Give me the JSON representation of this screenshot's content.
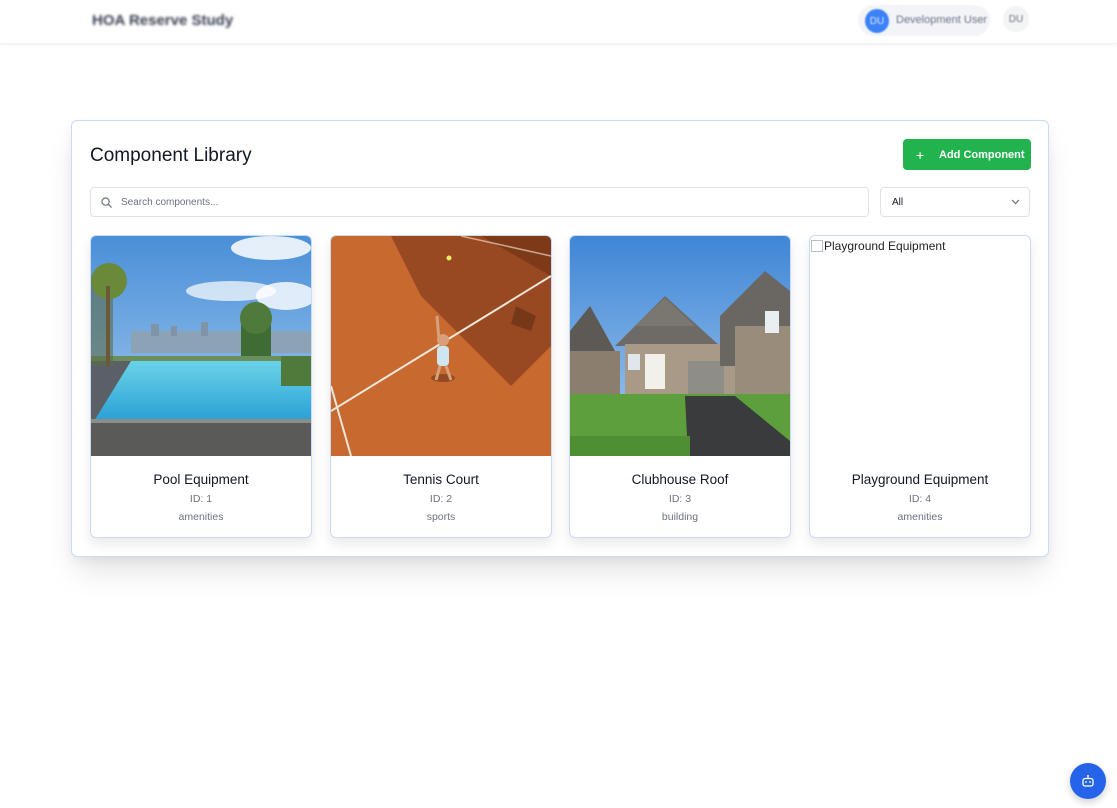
{
  "header": {
    "app_title": "HOA Reserve Study",
    "user_initials": "DU",
    "user_name": "Development User",
    "profile_initials": "DU"
  },
  "library": {
    "title": "Component Library",
    "add_button_label": "Add Component",
    "add_icon": "plus-icon",
    "search_placeholder": "Search components...",
    "search_value": "",
    "search_icon": "search-icon",
    "filter_value": "All",
    "filter_icon": "chevron-down-icon",
    "components": [
      {
        "name": "Pool Equipment",
        "id_label": "ID: 1",
        "category": "amenities",
        "image": "pool-photo"
      },
      {
        "name": "Tennis Court",
        "id_label": "ID: 2",
        "category": "sports",
        "image": "tennis-court-photo"
      },
      {
        "name": "Clubhouse Roof",
        "id_label": "ID: 3",
        "category": "building",
        "image": "house-photo"
      },
      {
        "name": "Playground Equipment",
        "id_label": "ID: 4",
        "category": "amenities",
        "image_alt": "Playground Equipment",
        "image": "broken-image"
      }
    ]
  },
  "assistant_button": {
    "icon": "bot-icon"
  },
  "colors": {
    "accent_green": "#22b34f",
    "accent_blue": "#2563eb",
    "card_border": "#c9dbf5"
  }
}
